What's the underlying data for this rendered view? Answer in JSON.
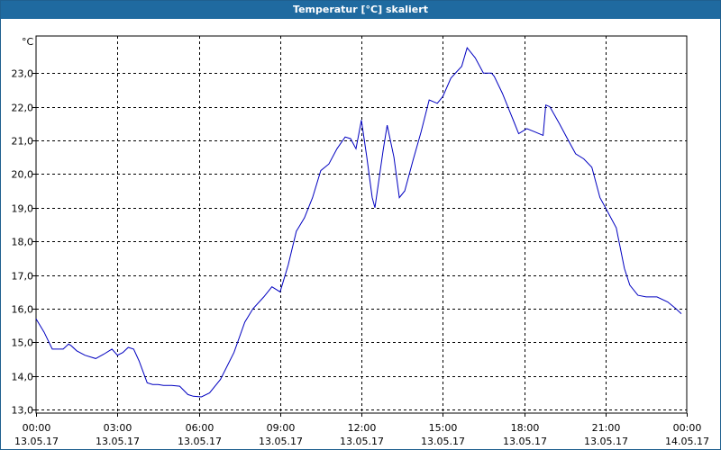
{
  "window": {
    "title": "Temperatur [°C] skaliert"
  },
  "colors": {
    "titlebar": "#1f6aa0",
    "series": "#0000c0",
    "grid": "#000000"
  },
  "chart_data": {
    "type": "line",
    "title": "Temperatur [°C] skaliert",
    "ylabel": "°C",
    "xlabel": "",
    "ylim": [
      12.9,
      24.1
    ],
    "yticks": [
      13.0,
      14.0,
      15.0,
      16.0,
      17.0,
      18.0,
      19.0,
      20.0,
      21.0,
      22.0,
      23.0
    ],
    "ytick_labels": [
      "13,0",
      "14,0",
      "15,0",
      "16,0",
      "17,0",
      "18,0",
      "19,0",
      "20,0",
      "21,0",
      "22,0",
      "23,0"
    ],
    "xlim_hours": [
      0,
      24
    ],
    "xticks_hours": [
      0,
      3,
      6,
      9,
      12,
      15,
      18,
      21,
      24
    ],
    "xtick_labels": [
      [
        "00:00",
        "13.05.17"
      ],
      [
        "03:00",
        "13.05.17"
      ],
      [
        "06:00",
        "13.05.17"
      ],
      [
        "09:00",
        "13.05.17"
      ],
      [
        "12:00",
        "13.05.17"
      ],
      [
        "15:00",
        "13.05.17"
      ],
      [
        "18:00",
        "13.05.17"
      ],
      [
        "21:00",
        "13.05.17"
      ],
      [
        "00:00",
        "14.05.17"
      ]
    ],
    "grid": true,
    "series": [
      {
        "x_hours": [
          0,
          0.3,
          0.6,
          0.7,
          1.0,
          1.2,
          1.3,
          1.5,
          1.8,
          2.2,
          2.5,
          2.8,
          3.0,
          3.2,
          3.4,
          3.6,
          3.8,
          4.1,
          4.3,
          4.5,
          4.7,
          5.0,
          5.3,
          5.6,
          5.8,
          6.1,
          6.4,
          6.8,
          7.3,
          7.7,
          8.0,
          8.4,
          8.7,
          9.0,
          9.3,
          9.6,
          9.9,
          10.2,
          10.5,
          10.8,
          11.1,
          11.4,
          11.6,
          11.8,
          12.0,
          12.2,
          12.4,
          12.5,
          12.8,
          12.95,
          13.2,
          13.4,
          13.6,
          13.9,
          14.2,
          14.5,
          14.8,
          15.0,
          15.3,
          15.7,
          15.9,
          16.2,
          16.5,
          16.8,
          16.9,
          17.2,
          17.6,
          17.8,
          18.1,
          18.4,
          18.7,
          18.8,
          18.95,
          19.3,
          19.6,
          19.9,
          20.2,
          20.5,
          20.8,
          21.0,
          21.4,
          21.7,
          21.9,
          22.2,
          22.5,
          22.9,
          23.3,
          23.6,
          23.8
        ],
        "y": [
          15.7,
          15.3,
          14.8,
          14.8,
          14.8,
          14.95,
          14.9,
          14.75,
          14.62,
          14.52,
          14.65,
          14.8,
          14.62,
          14.7,
          14.85,
          14.8,
          14.45,
          13.8,
          13.75,
          13.75,
          13.72,
          13.72,
          13.7,
          13.45,
          13.4,
          13.38,
          13.5,
          13.9,
          14.7,
          15.6,
          16.0,
          16.35,
          16.65,
          16.5,
          17.3,
          18.3,
          18.7,
          19.3,
          20.1,
          20.3,
          20.75,
          21.1,
          21.05,
          20.75,
          21.6,
          20.5,
          19.3,
          19.0,
          20.7,
          21.45,
          20.5,
          19.3,
          19.5,
          20.4,
          21.25,
          22.2,
          22.1,
          22.3,
          22.85,
          23.2,
          23.75,
          23.45,
          23.0,
          23.0,
          22.9,
          22.4,
          21.6,
          21.2,
          21.35,
          21.25,
          21.15,
          22.05,
          22.0,
          21.5,
          21.05,
          20.6,
          20.45,
          20.2,
          19.3,
          19.0,
          18.4,
          17.2,
          16.7,
          16.4,
          16.35,
          16.35,
          16.2,
          16.0,
          15.85
        ]
      }
    ]
  }
}
